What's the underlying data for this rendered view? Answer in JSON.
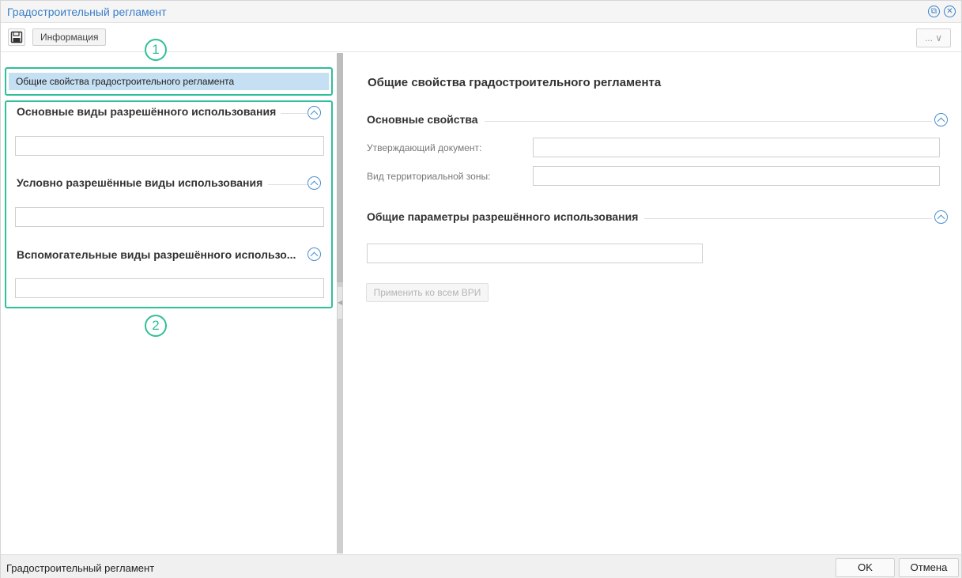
{
  "window": {
    "title": "Градостроительный регламент"
  },
  "titlebar_icons": [
    "restore-icon",
    "close-icon"
  ],
  "toolbar": {
    "save_icon": "floppy-disk-icon",
    "info_label": "Информация",
    "more_label": "... ∨"
  },
  "annotations": {
    "num1": "1",
    "num2": "2",
    "color": "#2fbf99"
  },
  "left_pane": {
    "nav_item": "Общие свойства градостроительного регламента",
    "sections": [
      {
        "title": "Основные виды разрешённого использования",
        "value": ""
      },
      {
        "title": "Условно разрешённые виды использования",
        "value": ""
      },
      {
        "title": "Вспомогательные виды разрешённого использо...",
        "value": ""
      }
    ]
  },
  "right_pane": {
    "title": "Общие свойства градостроительного регламента",
    "main_props_title": "Основные свойства",
    "fields": [
      {
        "label": "Утверждающий документ:",
        "value": ""
      },
      {
        "label": "Вид территориальной зоны:",
        "value": ""
      }
    ],
    "params_title": "Общие параметры разрешённого использования",
    "params_value": "",
    "apply_label": "Применить ко всем ВРИ"
  },
  "statusbar": {
    "text": "Градостроительный регламент",
    "ok_label": "OK",
    "cancel_label": "Отмена"
  },
  "colors": {
    "accent": "#3a7ec6",
    "selection": "#c5dff3"
  }
}
